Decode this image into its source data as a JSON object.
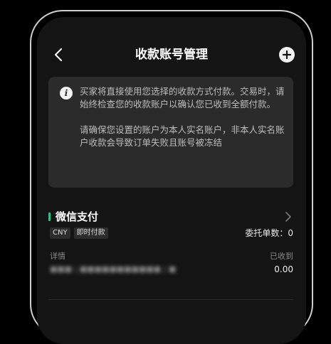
{
  "header": {
    "title": "收款账号管理",
    "back_icon": "chevron-left-icon",
    "add_icon": "plus-circle-icon"
  },
  "notice": {
    "icon": "info-icon",
    "paragraph1": "买家将直接使用您选择的收款方式付款。交易时，请始终检查您的收款账户以确认您已收到全额付款。",
    "paragraph2": "请确保您设置的账户为本人实名账户，非本人实名账户收款会导致订单失败且账号被冻结"
  },
  "account": {
    "name": "微信支付",
    "tags": [
      "CNY",
      "即时付款"
    ],
    "entrusted": "委托单数：0",
    "detail_label": "详情",
    "detail_value": "■■■ | ■■■■■■■■■■■ | ■",
    "received_label": "已收到",
    "received_value": "0.00"
  },
  "colors": {
    "accent_green": "#2ebd85",
    "card_bg": "#2b2b2b",
    "screen_bg": "#141414"
  }
}
